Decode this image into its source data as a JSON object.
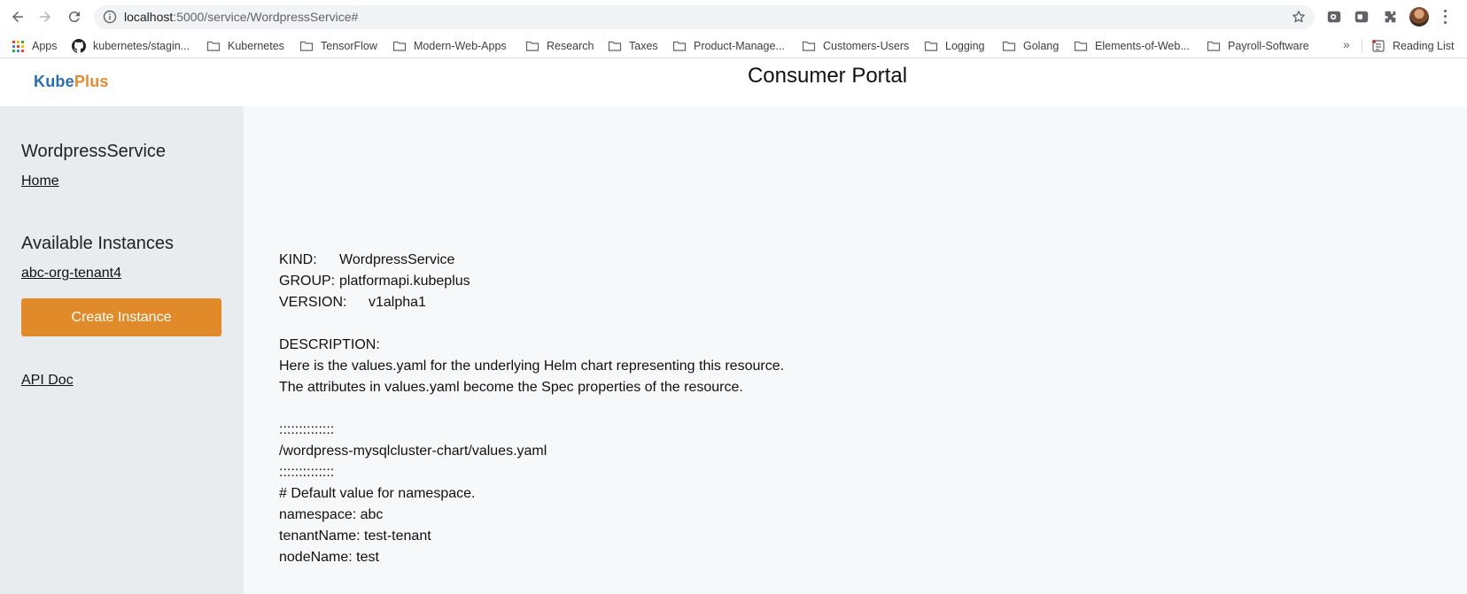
{
  "browser": {
    "url_host": "localhost",
    "url_path": ":5000/service/WordpressService#",
    "bookmarks": [
      {
        "label": "Apps",
        "icon": "apps-grid-icon"
      },
      {
        "label": "kubernetes/stagin...",
        "icon": "github-icon"
      },
      {
        "label": "Kubernetes",
        "icon": "folder-icon"
      },
      {
        "label": "TensorFlow",
        "icon": "folder-icon"
      },
      {
        "label": "Modern-Web-Apps",
        "icon": "folder-icon"
      },
      {
        "label": "Research",
        "icon": "folder-icon"
      },
      {
        "label": "Taxes",
        "icon": "folder-icon"
      },
      {
        "label": "Product-Manage...",
        "icon": "folder-icon"
      },
      {
        "label": "Customers-Users",
        "icon": "folder-icon"
      },
      {
        "label": "Logging",
        "icon": "folder-icon"
      },
      {
        "label": "Golang",
        "icon": "folder-icon"
      },
      {
        "label": "Elements-of-Web...",
        "icon": "folder-icon"
      },
      {
        "label": "Payroll-Software",
        "icon": "folder-icon"
      }
    ],
    "overflow_chevron": "»",
    "reading_list": "Reading List"
  },
  "header": {
    "logo_part1": "Kube",
    "logo_part2": "Plus",
    "title": "Consumer Portal"
  },
  "sidebar": {
    "service_name": "WordpressService",
    "home_link": "Home",
    "instances_heading": "Available Instances",
    "instances": [
      "abc-org-tenant4"
    ],
    "create_button": "Create Instance",
    "api_doc_link": "API Doc"
  },
  "main": {
    "kind_label": "KIND:",
    "kind_value": "WordpressService",
    "group_label": "GROUP:",
    "group_value": "platformapi.kubeplus",
    "version_label": "VERSION:",
    "version_value": "v1alpha1",
    "description_label": "DESCRIPTION:",
    "description_lines": [
      "Here is the values.yaml for the underlying Helm chart representing this resource.",
      "The attributes in values.yaml become the Spec properties of the resource."
    ],
    "separator": "::::::::::::::",
    "values_path": "/wordpress-mysqlcluster-chart/values.yaml",
    "yaml_lines": [
      "# Default value for namespace.",
      "namespace: abc",
      "tenantName: test-tenant",
      "nodeName: test"
    ]
  },
  "colors": {
    "accent_orange": "#e08a2a",
    "logo_blue": "#2a6fb6",
    "sidebar_bg": "#e9ecef",
    "main_bg": "#f7f8f9"
  }
}
